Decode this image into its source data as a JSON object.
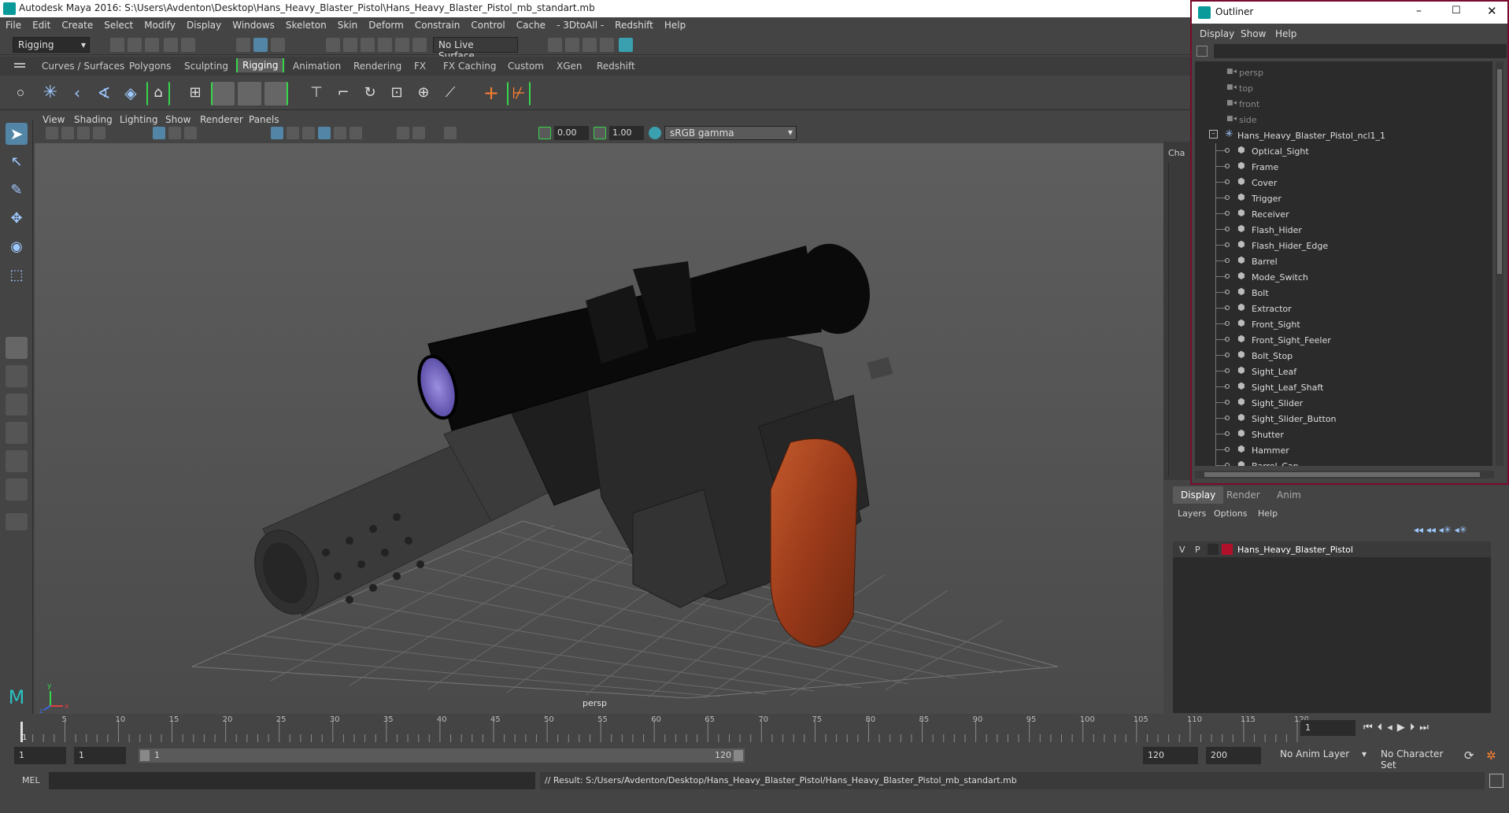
{
  "app": {
    "title": "Autodesk Maya 2016: S:\\Users\\Avdenton\\Desktop\\Hans_Heavy_Blaster_Pistol\\Hans_Heavy_Blaster_Pistol_mb_standart.mb"
  },
  "menubar": [
    "File",
    "Edit",
    "Create",
    "Select",
    "Modify",
    "Display",
    "Windows",
    "Skeleton",
    "Skin",
    "Deform",
    "Constrain",
    "Control",
    "Cache",
    "- 3DtoAll -",
    "Redshift",
    "Help"
  ],
  "statusline": {
    "mode": "Rigging",
    "live_surface": "No Live Surface"
  },
  "shelf_tabs": [
    "Curves / Surfaces",
    "Polygons",
    "Sculpting",
    "Rigging",
    "Animation",
    "Rendering",
    "FX",
    "FX Caching",
    "Custom",
    "XGen",
    "Redshift"
  ],
  "active_shelf_tab": "Rigging",
  "panel_menu": [
    "View",
    "Shading",
    "Lighting",
    "Show",
    "Renderer",
    "Panels"
  ],
  "panel_toolbar": {
    "exposure": "0.00",
    "gamma": "1.00",
    "colorspace": "sRGB gamma"
  },
  "viewport": {
    "camera_label": "persp",
    "axis_x": "x",
    "axis_y": "y",
    "axis_z": "z"
  },
  "outliner": {
    "title": "Outliner",
    "menu": [
      "Display",
      "Show",
      "Help"
    ],
    "cameras": [
      "persp",
      "top",
      "front",
      "side"
    ],
    "group": "Hans_Heavy_Blaster_Pistol_ncl1_1",
    "children": [
      "Optical_Sight",
      "Frame",
      "Cover",
      "Trigger",
      "Receiver",
      "Flash_Hider",
      "Flash_Hider_Edge",
      "Barrel",
      "Mode_Switch",
      "Bolt",
      "Extractor",
      "Front_Sight",
      "Front_Sight_Feeler",
      "Bolt_Stop",
      "Sight_Leaf",
      "Sight_Leaf_Shaft",
      "Sight_Slider",
      "Sight_Slider_Button",
      "Shutter",
      "Hammer",
      "Barrel_Cap"
    ]
  },
  "channel_box": {
    "tab_label": "Cha"
  },
  "layer_editor": {
    "tabs": [
      "Display",
      "Render",
      "Anim"
    ],
    "active_tab": "Display",
    "menu": [
      "Layers",
      "Options",
      "Help"
    ],
    "layer": {
      "v": "V",
      "p": "P",
      "name": "Hans_Heavy_Blaster_Pistol",
      "color": "#b0102a"
    }
  },
  "timeline": {
    "ticks": [
      "5",
      "10",
      "15",
      "20",
      "25",
      "30",
      "35",
      "40",
      "45",
      "50",
      "55",
      "60",
      "65",
      "70",
      "75",
      "80",
      "85",
      "90",
      "95",
      "100",
      "105",
      "110",
      "115",
      "120"
    ],
    "start_marker": "1",
    "current_frame": "1"
  },
  "range": {
    "start": "1",
    "playback_start": "1",
    "range_start_label": "1",
    "range_end_label": "120",
    "playback_end": "120",
    "end": "200",
    "anim_layer": "No Anim Layer",
    "char_set": "No Character Set"
  },
  "cmdline": {
    "lang": "MEL",
    "result": "// Result: S:/Users/Avdenton/Desktop/Hans_Heavy_Blaster_Pistol/Hans_Heavy_Blaster_Pistol_mb_standart.mb"
  },
  "colors": {
    "accent_green": "#37d64a",
    "outliner_border": "#7a0a2c",
    "select_blue": "#5285a6"
  }
}
